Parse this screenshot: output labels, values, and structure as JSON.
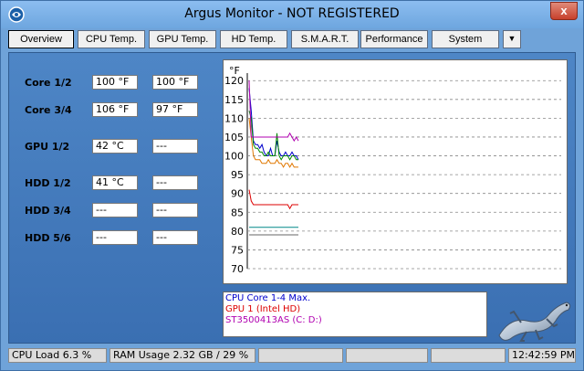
{
  "window": {
    "title": "Argus Monitor - NOT REGISTERED",
    "close_label": "x"
  },
  "tabs": [
    {
      "label": "Overview"
    },
    {
      "label": "CPU Temp."
    },
    {
      "label": "GPU Temp."
    },
    {
      "label": "HD Temp."
    },
    {
      "label": "S.M.A.R.T."
    },
    {
      "label": "Performance"
    },
    {
      "label": "System"
    }
  ],
  "tabs_dropdown": "▼",
  "readings": [
    {
      "label": "Core 1/2",
      "v1": "100 °F",
      "v2": "100 °F"
    },
    {
      "label": "Core 3/4",
      "v1": "106 °F",
      "v2": "97 °F"
    },
    {
      "label": "GPU 1/2",
      "v1": "42 °C",
      "v2": "---"
    },
    {
      "label": "HDD 1/2",
      "v1": "41 °C",
      "v2": "---"
    },
    {
      "label": "HDD 3/4",
      "v1": "---",
      "v2": "---"
    },
    {
      "label": "HDD 5/6",
      "v1": "---",
      "v2": "---"
    }
  ],
  "legend": [
    {
      "label": "CPU Core 1-4 Max.",
      "color": "#0000cc"
    },
    {
      "label": "GPU 1 (Intel HD)",
      "color": "#dd0000"
    },
    {
      "label": "ST3500413AS (C: D:)",
      "color": "#b000b0"
    }
  ],
  "status": {
    "cpu_load": "CPU Load 6.3 %",
    "ram": "RAM Usage 2.32 GB / 29 %",
    "time": "12:42:59 PM"
  },
  "chart_data": {
    "type": "line",
    "ylabel": "°F",
    "ylim": [
      70,
      122
    ],
    "yticks": [
      120,
      115,
      110,
      105,
      100,
      95,
      90,
      85,
      80,
      75,
      70
    ],
    "grid": true,
    "series": [
      {
        "name": "CPU Core 1-4 Max.",
        "color": "#0000cc",
        "values": [
          118,
          112,
          104,
          103,
          103,
          102,
          103,
          101,
          100,
          100,
          102,
          100,
          100,
          104,
          101,
          100,
          100,
          101,
          100,
          100,
          101,
          100,
          100,
          99
        ]
      },
      {
        "name": "",
        "color": "#008800",
        "values": [
          112,
          110,
          103,
          102,
          102,
          101,
          101,
          100,
          100,
          101,
          100,
          100,
          100,
          106,
          100,
          99,
          100,
          100,
          100,
          99,
          100,
          100,
          99,
          99
        ]
      },
      {
        "name": "",
        "color": "#e07800",
        "values": [
          110,
          105,
          100,
          99,
          99,
          99,
          98,
          98,
          98,
          99,
          98,
          98,
          98,
          99,
          98,
          98,
          97,
          98,
          98,
          97,
          98,
          97,
          97,
          97
        ]
      },
      {
        "name": "ST3500413AS (C: D:)",
        "color": "#b000b0",
        "values": [
          120,
          105,
          105,
          105,
          105,
          105,
          105,
          105,
          105,
          105,
          105,
          105,
          105,
          105,
          105,
          105,
          105,
          105,
          105,
          106,
          105,
          104,
          105,
          104
        ]
      },
      {
        "name": "GPU 1 (Intel HD)",
        "color": "#dd0000",
        "values": [
          91,
          88,
          87,
          87,
          87,
          87,
          87,
          87,
          87,
          87,
          87,
          87,
          87,
          87,
          87,
          87,
          87,
          87,
          87,
          86,
          87,
          87,
          87,
          87
        ]
      },
      {
        "name": "",
        "color": "#008888",
        "values": [
          81,
          81,
          81,
          81,
          81,
          81,
          81,
          81,
          81,
          81,
          81,
          81,
          81,
          81,
          81,
          81,
          81,
          81,
          81,
          81,
          81,
          81,
          81,
          81
        ]
      },
      {
        "name": "",
        "color": "#666666",
        "values": [
          79,
          79,
          79,
          79,
          79,
          79,
          79,
          79,
          79,
          79,
          79,
          79,
          79,
          79,
          79,
          79,
          79,
          79,
          79,
          79,
          79,
          79,
          79,
          79
        ]
      }
    ]
  }
}
